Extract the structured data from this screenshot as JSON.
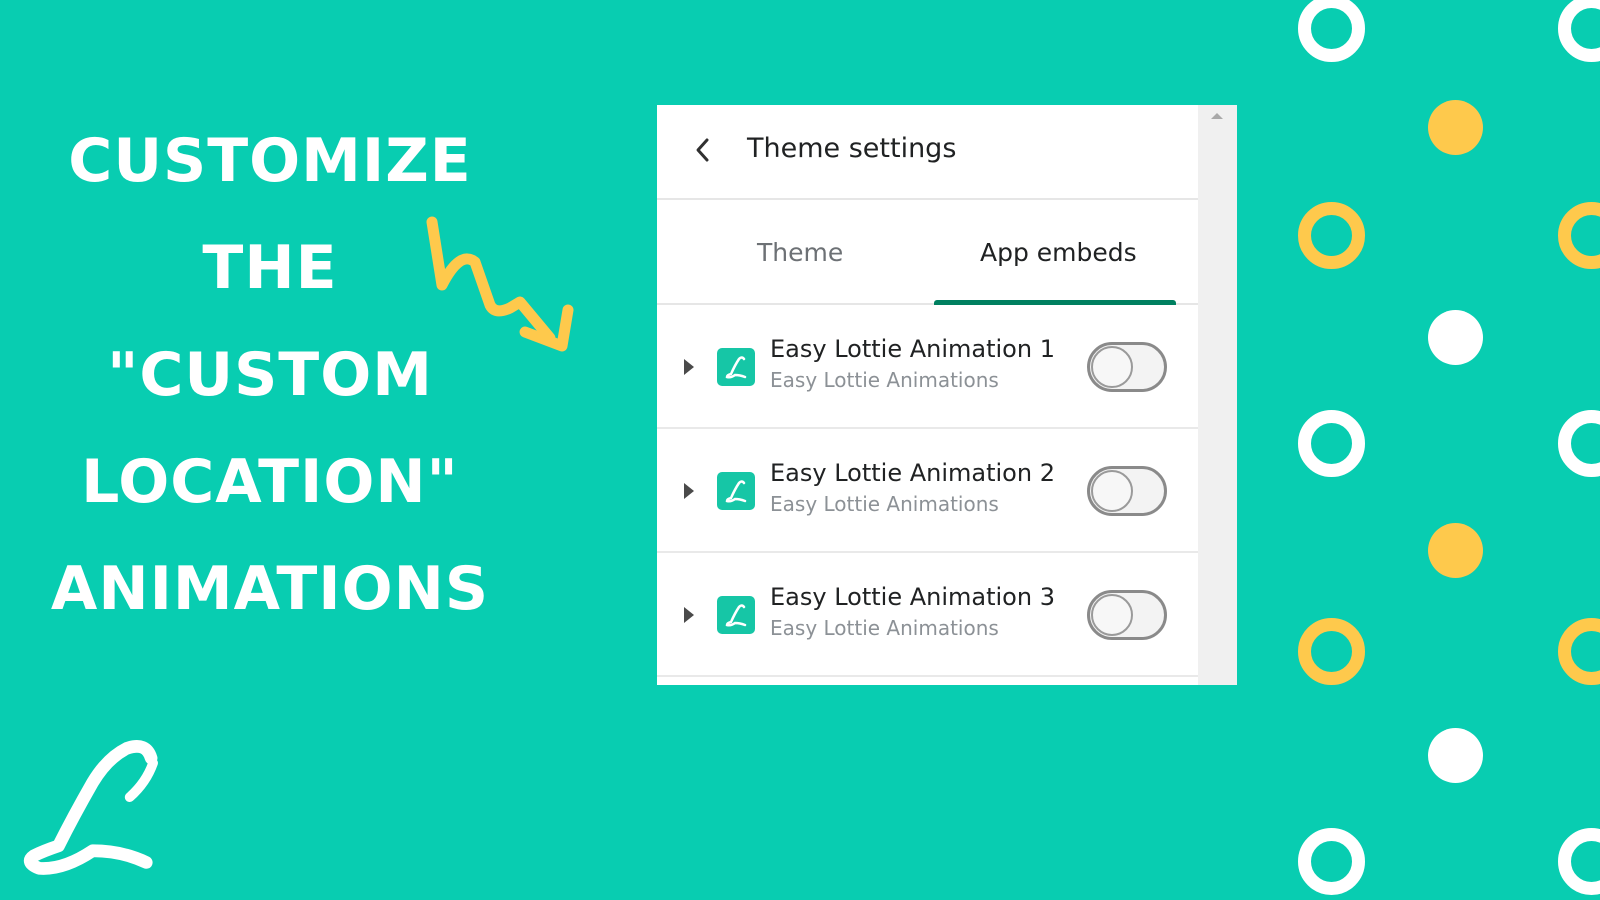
{
  "colors": {
    "background": "#08cdb1",
    "accent_yellow": "#fec94c",
    "tab_active": "#008060",
    "app_icon": "#16c6a6"
  },
  "headline": {
    "lines": [
      "Customize",
      "the",
      "\"Custom",
      "Location\"",
      "Animations"
    ]
  },
  "panel": {
    "back_icon": "chevron-left-icon",
    "title": "Theme settings",
    "tabs": [
      {
        "label": "Theme",
        "active": false
      },
      {
        "label": "App embeds",
        "active": true
      }
    ],
    "embeds": [
      {
        "title": "Easy Lottie Animation 1",
        "subtitle": "Easy Lottie Animations",
        "enabled": false
      },
      {
        "title": "Easy Lottie Animation 2",
        "subtitle": "Easy Lottie Animations",
        "enabled": false
      },
      {
        "title": "Easy Lottie Animation 3",
        "subtitle": "Easy Lottie Animations",
        "enabled": false
      }
    ]
  },
  "logo": {
    "letter": "L",
    "icon": "lottie-logo-icon"
  }
}
